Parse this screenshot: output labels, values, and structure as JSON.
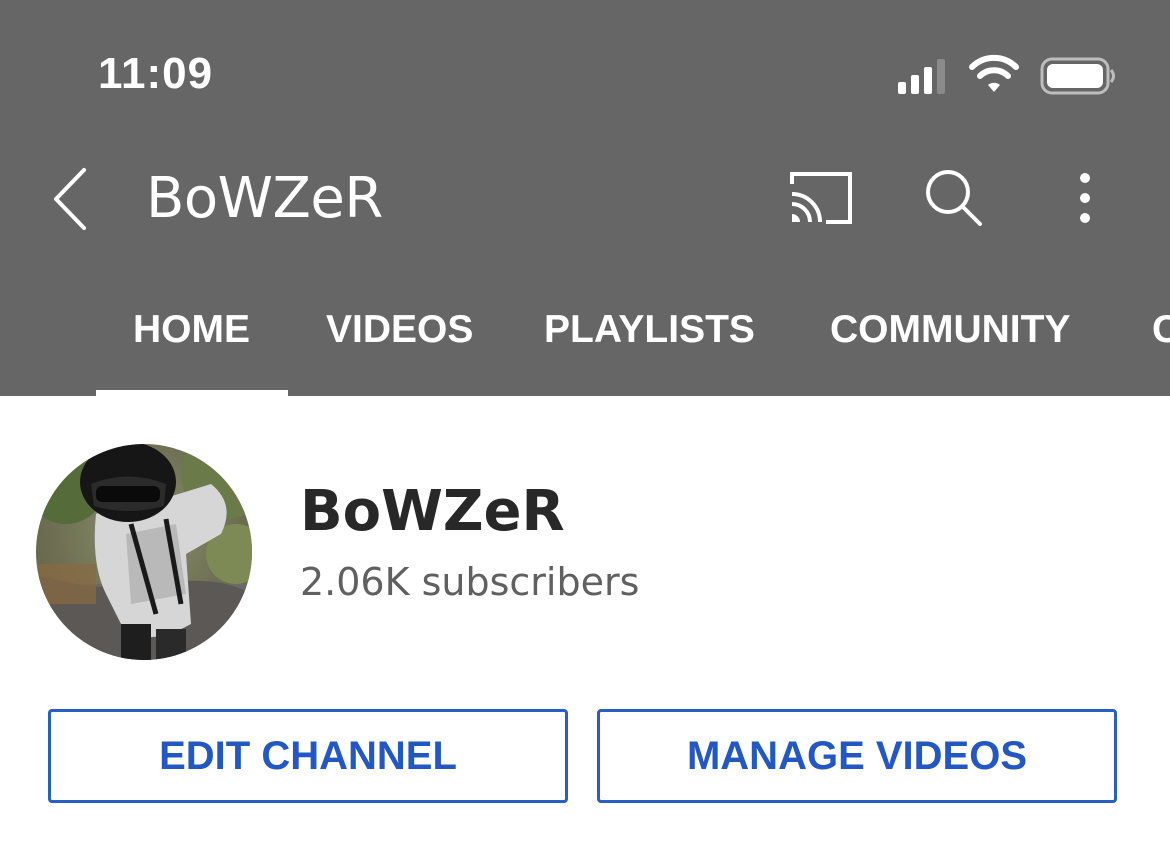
{
  "status_bar": {
    "time": "11:09",
    "icons": [
      "signal-icon",
      "wifi-icon",
      "battery-icon"
    ]
  },
  "app_bar": {
    "title": "BoWZeR",
    "icons": [
      "back-icon",
      "cast-icon",
      "search-icon",
      "more-vert-icon"
    ]
  },
  "tabs": [
    {
      "label": "HOME",
      "selected": true
    },
    {
      "label": "VIDEOS",
      "selected": false
    },
    {
      "label": "PLAYLISTS",
      "selected": false
    },
    {
      "label": "COMMUNITY",
      "selected": false
    },
    {
      "label": "C",
      "selected": false
    }
  ],
  "channel": {
    "name": "BoWZeR",
    "subscribers": "2.06K subscribers"
  },
  "buttons": {
    "edit_channel": "EDIT CHANNEL",
    "manage_videos": "MANAGE VIDEOS"
  },
  "colors": {
    "header_bg": "#666666",
    "accent_blue": "#2358c4",
    "title_text": "#282828",
    "secondary_text": "#606060"
  }
}
